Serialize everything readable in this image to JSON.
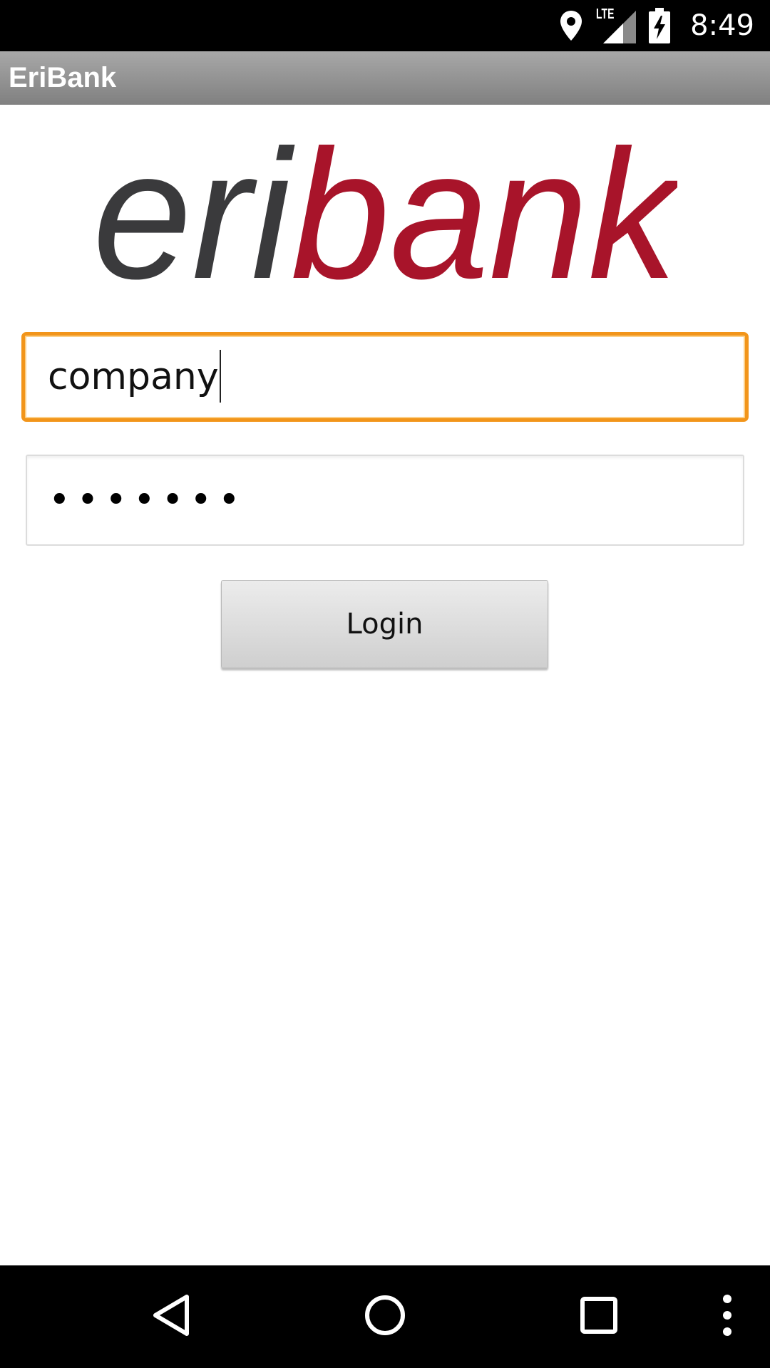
{
  "status_bar": {
    "time": "8:49",
    "network_label": "LTE",
    "icons": [
      "location-icon",
      "signal-icon",
      "battery-charging-icon"
    ]
  },
  "action_bar": {
    "title": "EriBank"
  },
  "logo": {
    "part1": "eri",
    "part2": "bank",
    "part1_color": "#3a3a3c",
    "part2_color": "#a8142a"
  },
  "login_form": {
    "username_value": "company",
    "password_mask": "•••••••",
    "login_label": "Login",
    "focus_color": "#f2951a"
  },
  "nav_bar": {
    "icons": [
      "back-icon",
      "home-icon",
      "recents-icon",
      "overflow-menu-icon"
    ]
  }
}
